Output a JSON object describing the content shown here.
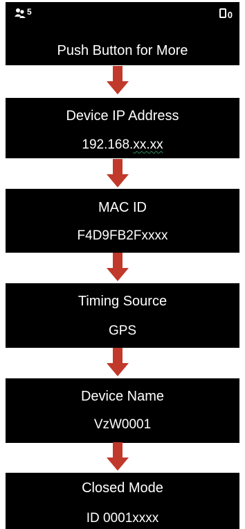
{
  "status": {
    "users_count": "5",
    "devices_count": "0",
    "users_icon": "users-icon",
    "device_icon": "phone-outline-icon"
  },
  "screens": [
    {
      "lines": [
        "Push Button for More"
      ]
    },
    {
      "lines": [
        "Device IP Address",
        "192.168.",
        "xx.xx"
      ]
    },
    {
      "lines": [
        "MAC ID",
        "F4D9FB2Fxxxx"
      ]
    },
    {
      "lines": [
        "Timing Source",
        "GPS"
      ]
    },
    {
      "lines": [
        "Device Name",
        "VzW0001"
      ]
    },
    {
      "lines": [
        "Closed Mode",
        "ID 0001xxxx"
      ]
    }
  ],
  "colors": {
    "screen_background": "#000000",
    "screen_text": "#ffffff",
    "arrow_fill": "#c0392b",
    "spellcheck_underline": "#2e8b57"
  }
}
